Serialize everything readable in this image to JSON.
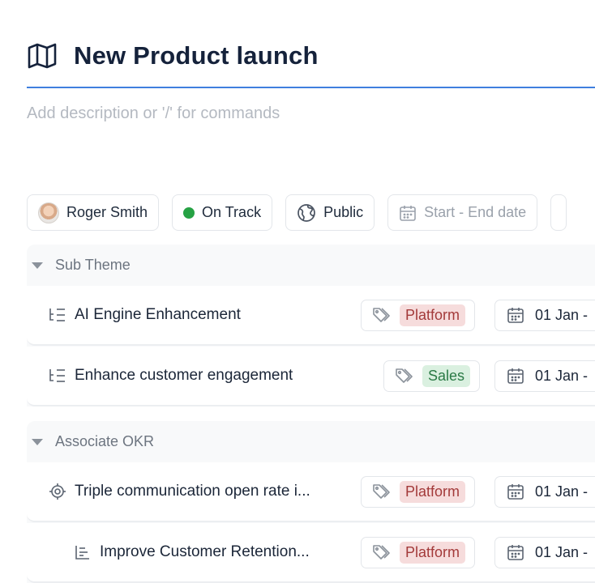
{
  "header": {
    "icon": "map-icon",
    "title": "New Product launch",
    "description_placeholder": "Add description or '/' for commands"
  },
  "chips": {
    "owner": "Roger Smith",
    "status": "On Track",
    "status_color": "#26a244",
    "visibility": "Public",
    "date_placeholder": "Start - End date"
  },
  "sections": [
    {
      "title": "Sub Theme",
      "rows": [
        {
          "icon": "subtheme-list-icon",
          "title": "AI Engine Enhancement",
          "tag": "Platform",
          "date": "01 Jan -"
        },
        {
          "icon": "subtheme-list-icon",
          "title": "Enhance customer engagement",
          "tag": "Sales",
          "date": "01 Jan -"
        }
      ]
    },
    {
      "title": "Associate OKR",
      "rows": [
        {
          "icon": "target-icon",
          "title": "Triple communication open rate i...",
          "tag": "Platform",
          "date": "01 Jan -"
        },
        {
          "icon": "key-result-icon",
          "title": "Improve Customer Retention...",
          "tag": "Platform",
          "date": "01 Jan -"
        }
      ]
    }
  ],
  "colors": {
    "accent": "#3f7fde",
    "platform_bg": "#f6dcdc",
    "platform_text": "#a33a3a",
    "sales_bg": "#daf0e0",
    "sales_text": "#2a7a45"
  }
}
